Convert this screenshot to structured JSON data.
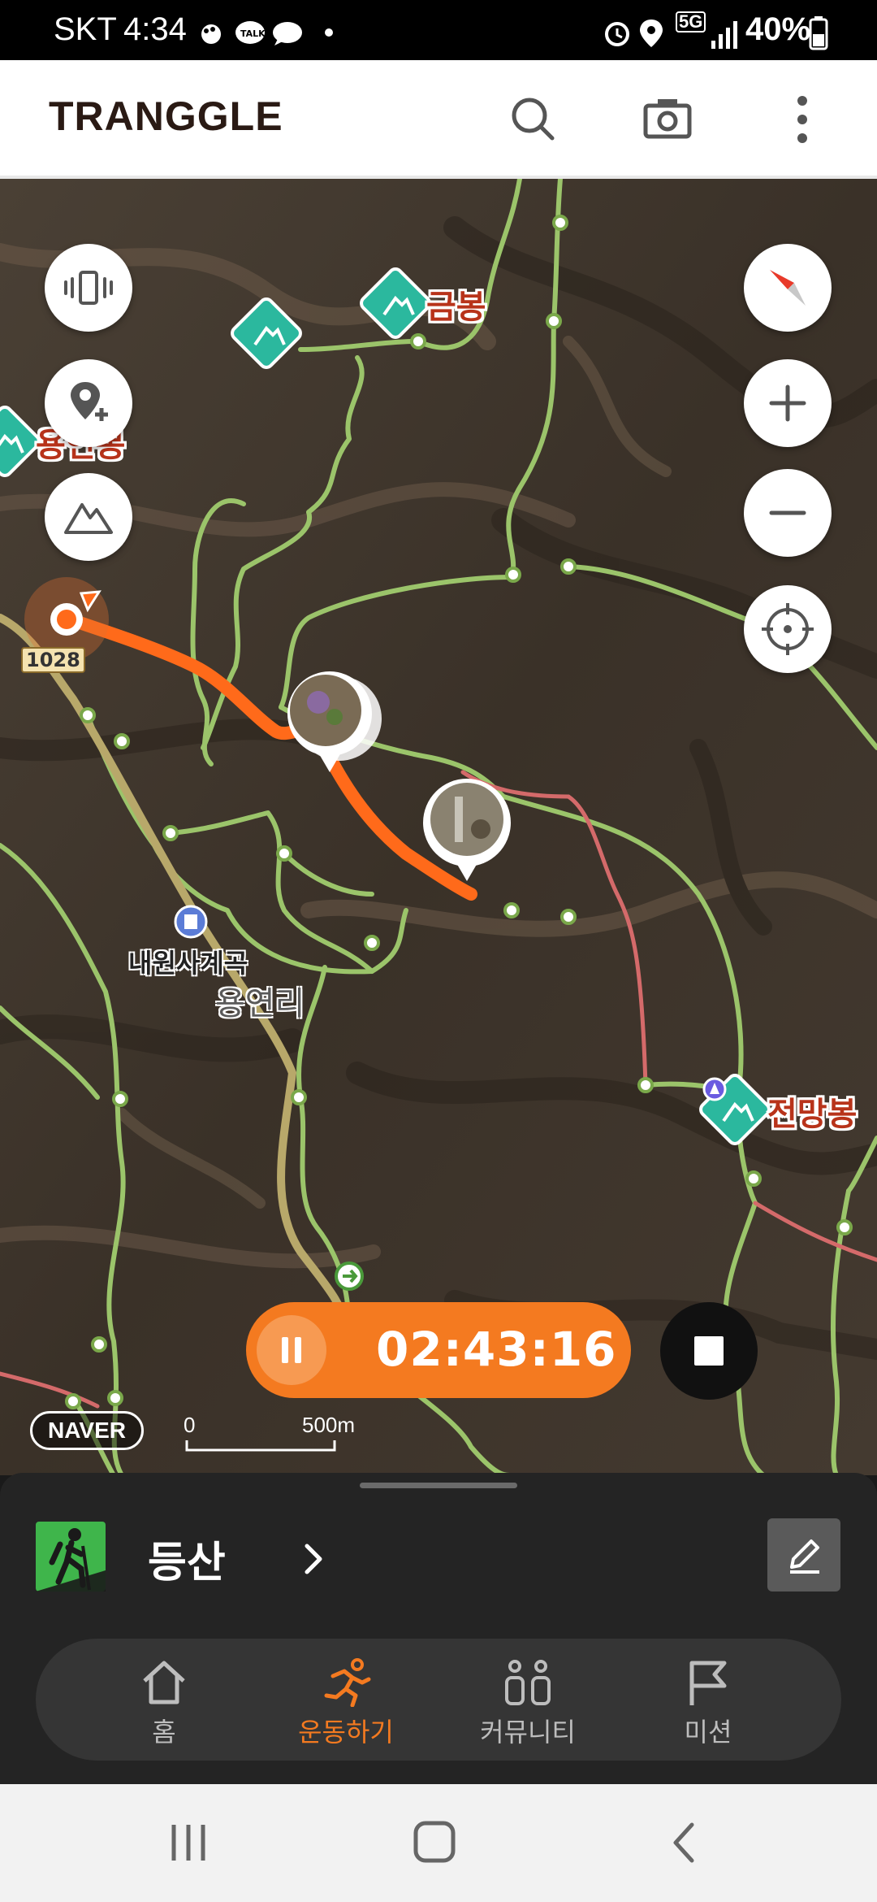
{
  "status_bar": {
    "carrier": "SKT",
    "time": "4:34",
    "network": "5G",
    "battery": "40%",
    "notification_icons": [
      "footprint-icon",
      "kakaotalk-icon",
      "chat-icon",
      "weather-icon",
      "dot-icon"
    ],
    "system_icons": [
      "alarm-icon",
      "location-icon",
      "5g-icon",
      "signal-icon",
      "battery-icon"
    ]
  },
  "app_bar": {
    "logo": "TRANGGLE",
    "actions": [
      "search-icon",
      "camera-icon",
      "more-vert-icon"
    ]
  },
  "map": {
    "peaks": [
      {
        "name": "금봉"
      },
      {
        "name": "용연봉"
      },
      {
        "name": "전망봉"
      }
    ],
    "places": {
      "valley": "내원사계곡",
      "village": "용연리",
      "road_number": "1028"
    },
    "scale": {
      "zero": "0",
      "distance": "500m"
    },
    "attribution": "NAVER",
    "left_controls": [
      "vibration-icon",
      "add-location-icon",
      "mountain-icon"
    ],
    "right_controls": [
      "compass-icon",
      "zoom-in-icon",
      "zoom-out-icon",
      "current-location-icon"
    ]
  },
  "recording": {
    "elapsed": "02:43:16",
    "pause": "pause-icon",
    "stop": "stop-icon"
  },
  "activity": {
    "name": "등산",
    "icon": "hiking-icon"
  },
  "bottom_nav": {
    "items": [
      {
        "label": "홈",
        "icon": "home-icon",
        "active": false
      },
      {
        "label": "운동하기",
        "icon": "running-icon",
        "active": true
      },
      {
        "label": "커뮤니티",
        "icon": "community-icon",
        "active": false
      },
      {
        "label": "미션",
        "icon": "flag-icon",
        "active": false
      }
    ]
  },
  "colors": {
    "accent": "#f47a20",
    "peak_marker": "#2bb89e",
    "trail": "#9bc46a",
    "route": "#ff6a1a"
  }
}
